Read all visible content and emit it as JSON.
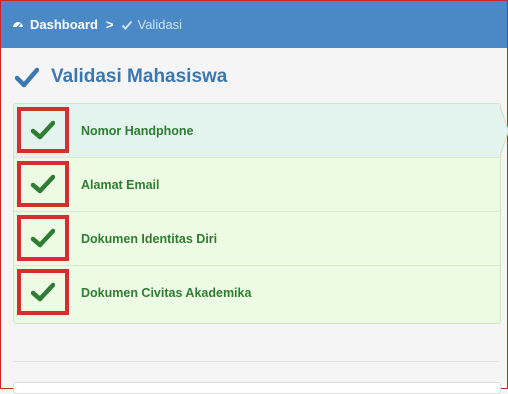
{
  "breadcrumb": {
    "home_label": "Dashboard",
    "separator": ">",
    "current_label": "Validasi"
  },
  "page": {
    "title": "Validasi Mahasiswa"
  },
  "validation_items": [
    {
      "label": "Nomor Handphone",
      "status": "valid"
    },
    {
      "label": "Alamat Email",
      "status": "valid"
    },
    {
      "label": "Dokumen Identitas Diri",
      "status": "valid"
    },
    {
      "label": "Dokumen Civitas Akademika",
      "status": "valid"
    }
  ],
  "colors": {
    "topbar": "#4a88c6",
    "title": "#3b78b0",
    "check": "#2e7d32",
    "highlight_box": "#d32f2f",
    "item_bg": "#eefbe4"
  }
}
